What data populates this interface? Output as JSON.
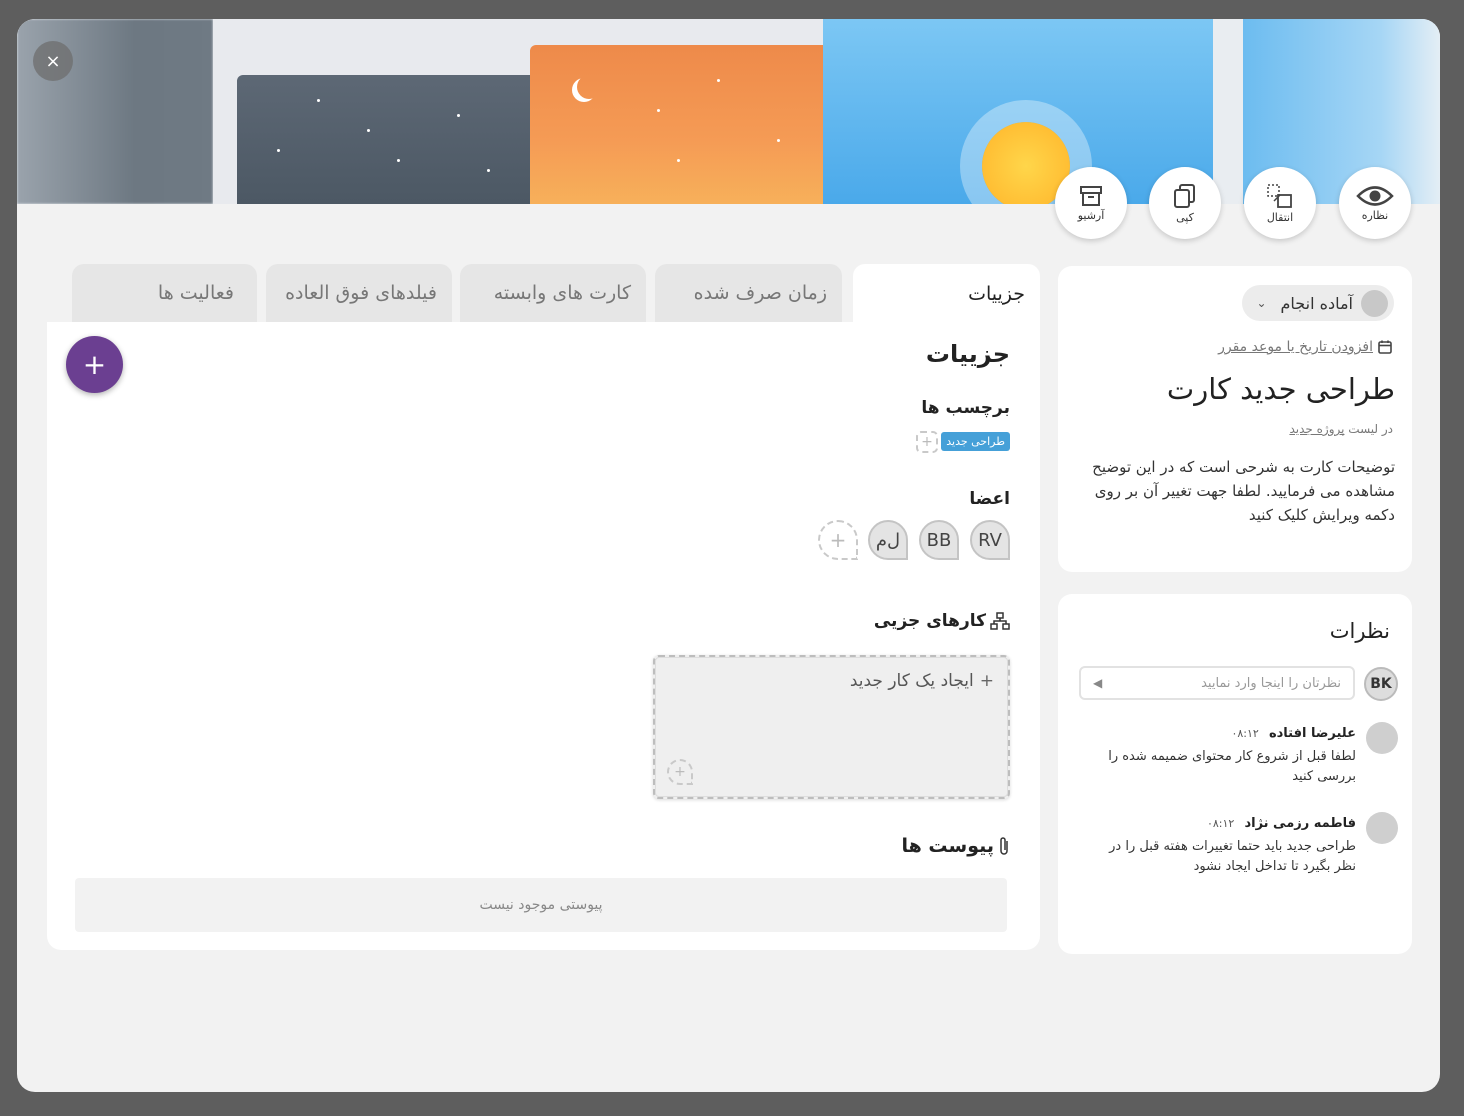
{
  "header": {
    "close_label": "×",
    "actions": [
      {
        "label": "نظاره",
        "icon": "eye-icon"
      },
      {
        "label": "انتقال",
        "icon": "move-icon"
      },
      {
        "label": "کپی",
        "icon": "copy-icon"
      },
      {
        "label": "آرشیو",
        "icon": "archive-icon"
      }
    ]
  },
  "info": {
    "status": "آماده انجام",
    "date_link": "افزودن تاریخ یا موعد مقرر",
    "title": "طراحی جدید کارت",
    "in_list_prefix": "در لیست",
    "in_list_name": "پروژه جدید",
    "description": "توضیحات کارت به شرحی است که در این توضیح مشاهده می فرمایید. لطفا جهت تغییر آن بر روی دکمه ویرایش کلیک کنید"
  },
  "comments": {
    "title": "نظرات",
    "my_initials": "BK",
    "placeholder": "نظرتان را اینجا وارد نمایید",
    "items": [
      {
        "name": "علیرضا افتاده",
        "time": "۰۸:۱۲",
        "text": "لطفا قبل از شروع کار محتوای ضمیمه شده را بررسی کنید"
      },
      {
        "name": "فاطمه رزمی نژاد",
        "time": "۰۸:۱۲",
        "text": "طراحی جدید باید حتما تغییرات هفته قبل را در نظر بگیرد تا تداخل ایجاد نشود"
      }
    ]
  },
  "tabs": [
    "جزییات",
    "زمان صرف شده",
    "کارت های وابسته",
    "فیلدهای فوق العاده",
    "فعالیت ها"
  ],
  "main": {
    "fab": "+",
    "title": "جزییات",
    "labels_title": "برچسب ها",
    "label_chip": "طراحی جدید",
    "members_title": "اعضا",
    "members": [
      "RV",
      "BB",
      "ل‌م"
    ],
    "subtasks_title": "کارهای جزیی",
    "new_subtask": "ایجاد یک کار جدید",
    "attachments_title": "پیوست ها",
    "attachments_empty": "پیوستی موجود نیست"
  },
  "colors": {
    "accent": "#6b3f91",
    "label_blue": "#45a0d8"
  }
}
